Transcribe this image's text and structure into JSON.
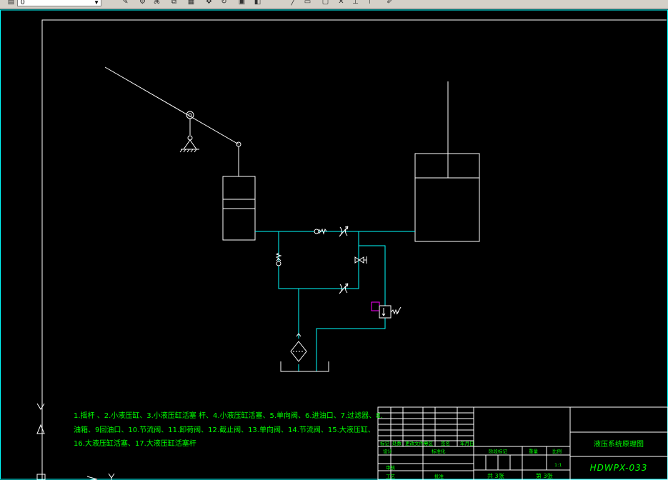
{
  "toolbar": {
    "layer_value": "0",
    "icons": [
      "edit-icon",
      "properties-icon",
      "match-icon",
      "copy-icon",
      "layer-icon",
      "move-icon",
      "rotate-icon",
      "scale-icon",
      "mirror-icon",
      "line-icon",
      "rect-icon",
      "trim-icon",
      "extend-icon",
      "explode-icon"
    ]
  },
  "legend": {
    "line1": "1.摇杆 、2.小液压缸、3.小液压缸活塞 杆、4.小液压缸活塞、5.单向阀、6.进油口、7.过滤器、8.",
    "line2": "油箱、9回油口、10.节流阀、11.卸荷阀、12.截止阀、13.单向阀、14.节流阀、15.大液压缸、",
    "line3": "16.大液压缸活塞、17.大液压缸活塞杆"
  },
  "title_block": {
    "drawing_title": "液压系统原理图",
    "drawing_number": "HDWPX-033",
    "sheet_total": "共 3张",
    "sheet_no": "第 3张",
    "scale": "1:1",
    "labels": {
      "mark": "标记",
      "count": "处数",
      "zone": "分区",
      "change_doc": "更改文件号",
      "signature": "签名",
      "date": "年月日",
      "design": "设计",
      "standardize": "标准化",
      "stage_mark": "阶段标记",
      "weight": "重量",
      "scale_label": "比例",
      "review": "审核",
      "process": "工艺",
      "approve": "批准"
    }
  },
  "colors": {
    "frame": "#00ffff",
    "drawing": "#ffffff",
    "pipe": "#00ffff",
    "text": "#00ff00",
    "relief": "#ff00ff"
  }
}
